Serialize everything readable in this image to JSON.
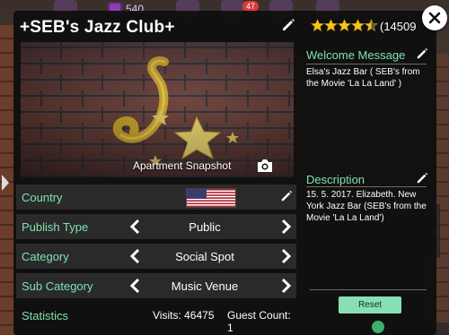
{
  "hud": {
    "gem_count": "540",
    "badge_count": "47"
  },
  "club": {
    "title": "+SEB's Jazz Club+",
    "rating_stars": 4.5,
    "rating_count": "(14509"
  },
  "snapshot": {
    "label": "Apartment Snapshot"
  },
  "welcome": {
    "title": "Welcome Message",
    "text": "Elsa's Jazz Bar ( SEB's from the Movie 'La La Land' )"
  },
  "description": {
    "title": "Description",
    "text": "15. 5. 2017. Elizabeth. New York Jazz Bar (SEB's from the Movie 'La La Land')"
  },
  "rows": {
    "country_label": "Country",
    "publish_label": "Publish Type",
    "publish_value": "Public",
    "category_label": "Category",
    "category_value": "Social Spot",
    "subcategory_label": "Sub Category",
    "subcategory_value": "Music Venue"
  },
  "stats": {
    "label": "Statistics",
    "visits": "Visits: 46475",
    "guests": "Guest Count: 1"
  },
  "reset_label": "Reset",
  "colors": {
    "accent": "#7fe3b0",
    "reset_button": "#86e0b4",
    "star": "#f5c518",
    "panel": "#0e0e0e"
  },
  "icons": [
    "gem-icon",
    "pencil-icon",
    "close-icon",
    "star-icon",
    "camera-icon",
    "chevron-left-icon",
    "chevron-right-icon",
    "us-flag-icon"
  ]
}
